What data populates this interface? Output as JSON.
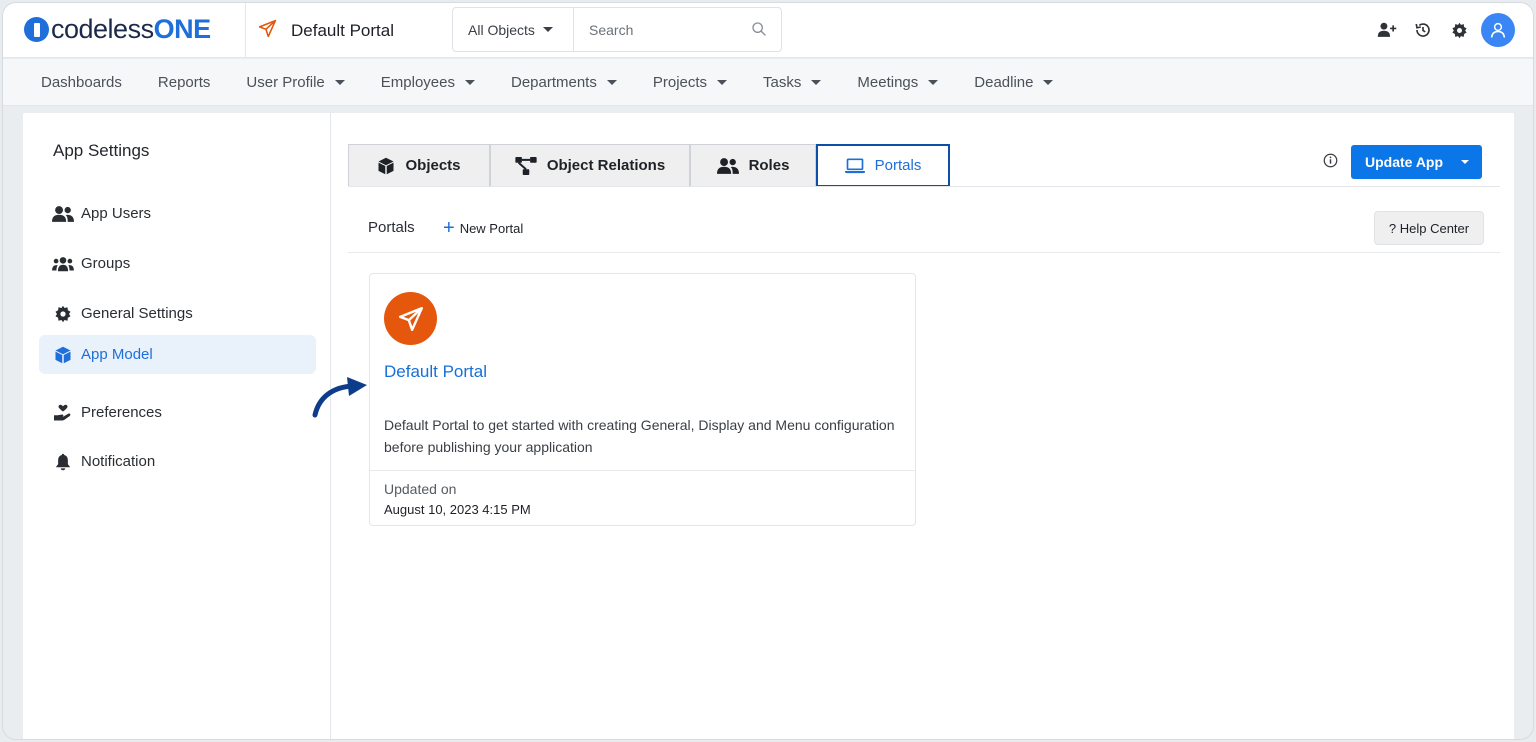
{
  "brand": {
    "logo_prefix": "codeless",
    "logo_suffix": "ONE"
  },
  "header": {
    "portal_name": "Default Portal",
    "search_scope": "All Objects",
    "search_placeholder": "Search"
  },
  "nav": {
    "items": [
      {
        "label": "Dashboards",
        "dropdown": false
      },
      {
        "label": "Reports",
        "dropdown": false
      },
      {
        "label": "User Profile",
        "dropdown": true
      },
      {
        "label": "Employees",
        "dropdown": true
      },
      {
        "label": "Departments",
        "dropdown": true
      },
      {
        "label": "Projects",
        "dropdown": true
      },
      {
        "label": "Tasks",
        "dropdown": true
      },
      {
        "label": "Meetings",
        "dropdown": true
      },
      {
        "label": "Deadline",
        "dropdown": true
      }
    ]
  },
  "sidebar": {
    "title": "App Settings",
    "items": [
      {
        "label": "App Users",
        "icon": "users-icon"
      },
      {
        "label": "Groups",
        "icon": "groups-icon"
      },
      {
        "label": "General Settings",
        "icon": "gear-icon"
      },
      {
        "label": "App Model",
        "icon": "cube-icon",
        "active": true
      },
      {
        "label": "Preferences",
        "icon": "hand-heart-icon"
      },
      {
        "label": "Notification",
        "icon": "bell-icon"
      }
    ]
  },
  "tabs": {
    "items": [
      {
        "label": "Objects",
        "icon": "cube-icon"
      },
      {
        "label": "Object Relations",
        "icon": "relations-icon"
      },
      {
        "label": "Roles",
        "icon": "users-icon"
      },
      {
        "label": "Portals",
        "icon": "laptop-icon",
        "active": true
      }
    ]
  },
  "actions": {
    "update_app": "Update App",
    "help_center": "? Help Center"
  },
  "portals": {
    "title": "Portals",
    "new_portal": "New Portal",
    "cards": [
      {
        "title": "Default Portal",
        "description": "Default Portal to get started with creating General, Display and Menu configuration before publishing your application",
        "updated_label": "Updated on",
        "updated_value": "August 10, 2023 4:15 PM",
        "badge_color": "#e4570c"
      }
    ]
  },
  "colors": {
    "accent": "#0b76e8",
    "link": "#1670d8",
    "brand_orange": "#e4570c"
  }
}
